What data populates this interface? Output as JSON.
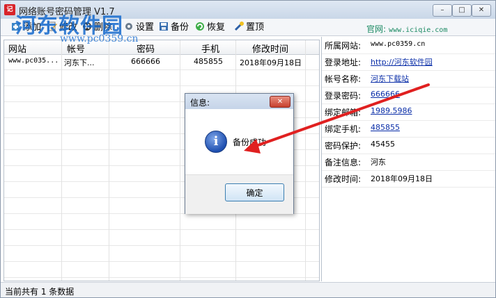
{
  "window": {
    "title": "网络账号密码管理 V1.7",
    "app_icon": "记",
    "watermark": "河东软件园",
    "watermark_url": "www.pc0359.cn",
    "controls": {
      "minimize": "–",
      "maximize": "□",
      "close": "✕"
    }
  },
  "toolbar": {
    "add": "添加",
    "edit": "修改",
    "delete": "删除",
    "settings": "设置",
    "backup": "备份",
    "restore": "恢复",
    "pin": "置顶",
    "official_label": "官网:",
    "official_url": "www.iciqie.com"
  },
  "grid": {
    "headers": [
      "网站",
      "帐号",
      "密码",
      "手机",
      "修改时间"
    ],
    "rows": [
      [
        "www.pc035...",
        "河东下...",
        "666666",
        "485855",
        "2018年09月18日"
      ]
    ]
  },
  "details": {
    "rows": [
      {
        "label": "所属网站:",
        "value": "www.pc0359.cn"
      },
      {
        "label": "登录地址:",
        "value": "http://河东软件园"
      },
      {
        "label": "帐号名称:",
        "value": "河东下载站"
      },
      {
        "label": "登录密码:",
        "value": "666666"
      },
      {
        "label": "绑定邮箱:",
        "value": "1989.5986"
      },
      {
        "label": "绑定手机:",
        "value": "485855"
      },
      {
        "label": "密码保护:",
        "value": "45455"
      },
      {
        "label": "备注信息:",
        "value": "河东"
      },
      {
        "label": "修改时间:",
        "value": "2018年09月18日"
      }
    ]
  },
  "status": {
    "text": "当前共有 1 条数据"
  },
  "dialog": {
    "title": "信息:",
    "close": "✕",
    "icon": "i",
    "message": "备份成功",
    "ok": "确定"
  },
  "colors": {
    "arrow": "#e02020",
    "link": "#0a2ea8",
    "watermark": "#1469cd",
    "official": "#1b8a63"
  }
}
